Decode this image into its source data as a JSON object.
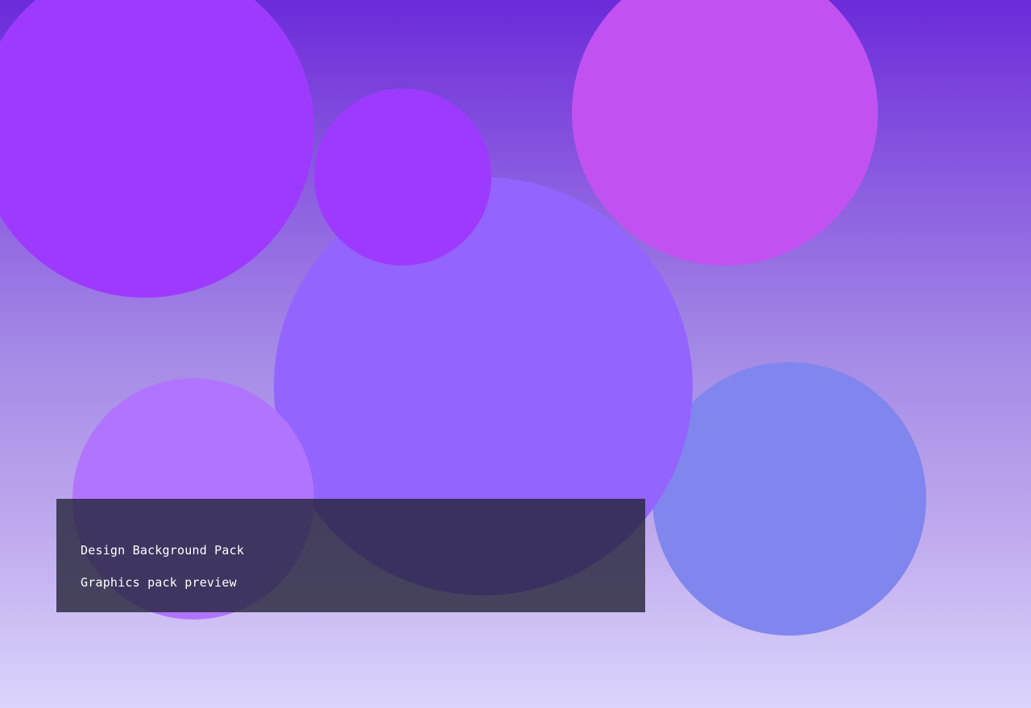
{
  "caption": {
    "title": "Design Background Pack",
    "subtitle": "Graphics pack preview"
  },
  "palette": {
    "background_top": "#6b2bd9",
    "background_bottom": "#dcd4fc",
    "panel": "#242438",
    "text": "#ffffff"
  },
  "circles": [
    {
      "id": "c-large-left",
      "color": "#9e3aff"
    },
    {
      "id": "c-small-top",
      "color": "#9e3aff"
    },
    {
      "id": "c-top-right",
      "color": "#c152f1"
    },
    {
      "id": "c-center",
      "color": "#9364fe"
    },
    {
      "id": "c-bottom-left",
      "color": "#b174fe"
    },
    {
      "id": "c-bottom-right",
      "color": "#8186ee"
    }
  ]
}
